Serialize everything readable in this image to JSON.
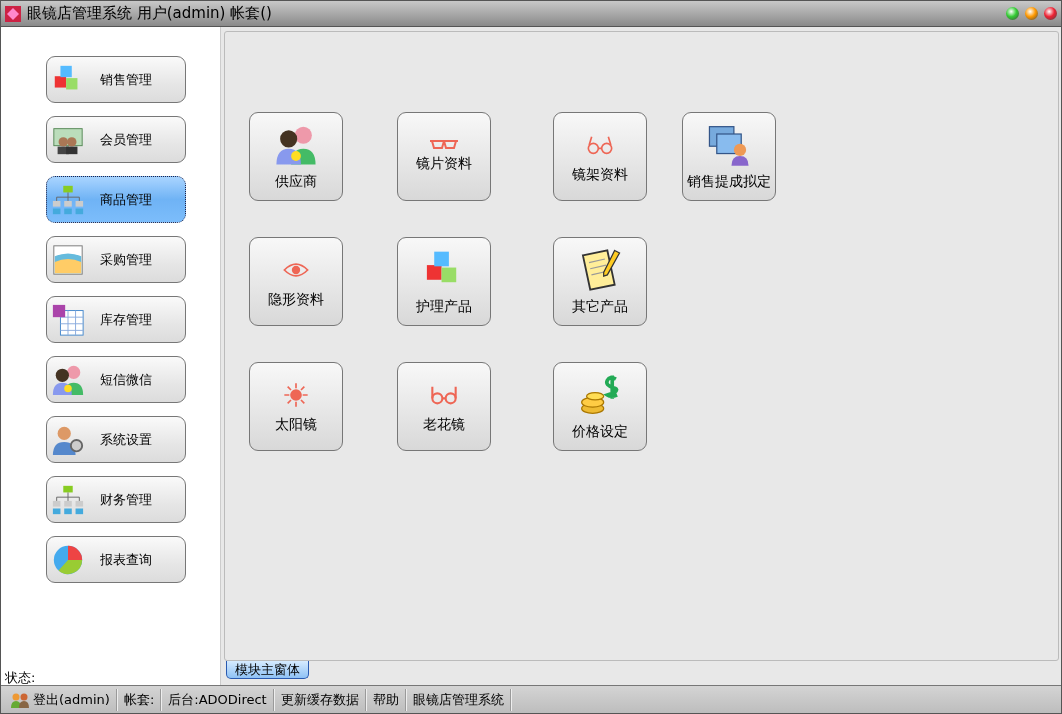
{
  "window": {
    "title": "眼镜店管理系统 用户(admin) 帐套()"
  },
  "sidebar": {
    "items": [
      {
        "label": "销售管理",
        "kind": "cubes",
        "selected": false
      },
      {
        "label": "会员管理",
        "kind": "members",
        "selected": false
      },
      {
        "label": "商品管理",
        "kind": "org",
        "selected": true
      },
      {
        "label": "采购管理",
        "kind": "chart",
        "selected": false
      },
      {
        "label": "库存管理",
        "kind": "table",
        "selected": false
      },
      {
        "label": "短信微信",
        "kind": "people",
        "selected": false
      },
      {
        "label": "系统设置",
        "kind": "user-gear",
        "selected": false
      },
      {
        "label": "财务管理",
        "kind": "org",
        "selected": false
      },
      {
        "label": "报表查询",
        "kind": "pie",
        "selected": false
      }
    ],
    "status_label": "状态:"
  },
  "modules": [
    [
      {
        "label": "供应商",
        "kind": "people"
      },
      {
        "label": "镜片资料",
        "kind": "glasses"
      },
      {
        "label": "镜架资料",
        "kind": "round-glasses"
      },
      {
        "label": "销售提成拟定",
        "kind": "folders"
      }
    ],
    [
      {
        "label": "隐形资料",
        "kind": "eye"
      },
      {
        "label": "护理产品",
        "kind": "cubes"
      },
      {
        "label": "其它产品",
        "kind": "notepad"
      }
    ],
    [
      {
        "label": "太阳镜",
        "kind": "sun"
      },
      {
        "label": "老花镜",
        "kind": "reading-glasses"
      },
      {
        "label": "价格设定",
        "kind": "coins"
      }
    ]
  ],
  "tabs": [
    {
      "label": "模块主窗体",
      "selected": true
    }
  ],
  "status_bar": [
    {
      "label": "登出(admin)",
      "kind": "logout"
    },
    {
      "label": "帐套:",
      "kind": "text"
    },
    {
      "label": "后台:ADODirect",
      "kind": "text"
    },
    {
      "label": "更新缓存数据",
      "kind": "text"
    },
    {
      "label": "帮助",
      "kind": "text"
    },
    {
      "label": "眼镜店管理系统",
      "kind": "text"
    }
  ]
}
